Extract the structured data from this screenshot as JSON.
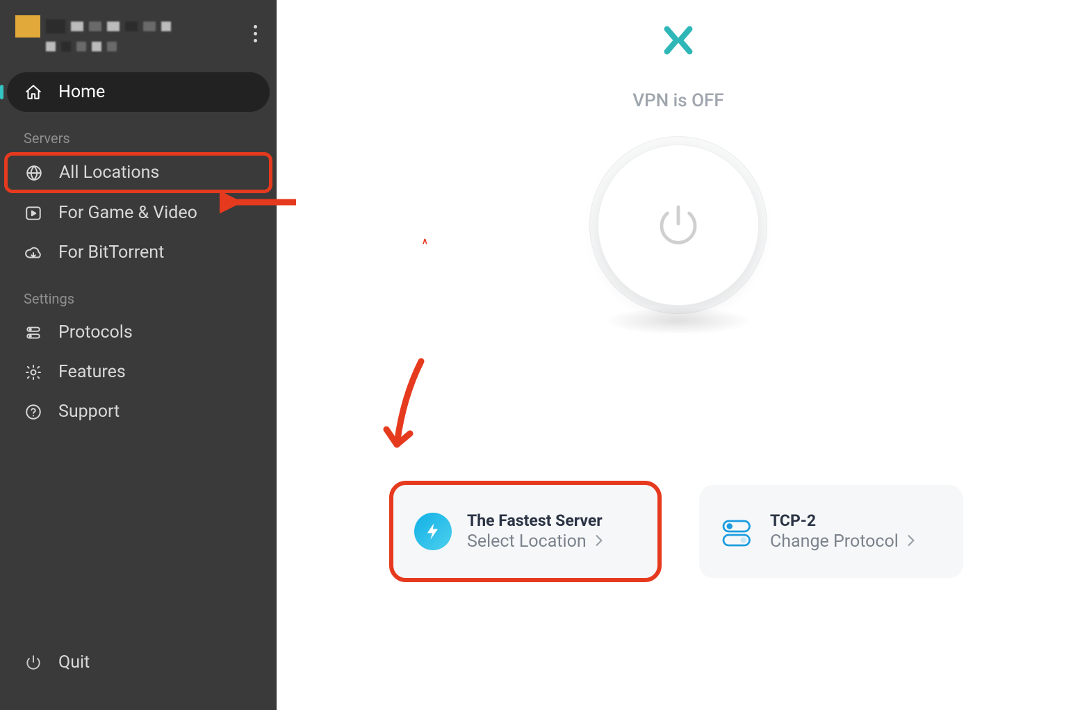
{
  "colors": {
    "accent": "#35c4c4",
    "annotate": "#e63a1f",
    "sidebar_bg": "#3a3a3b",
    "muted": "#8f8f90"
  },
  "sidebar": {
    "home_label": "Home",
    "section_servers": "Servers",
    "section_settings": "Settings",
    "items": {
      "all_locations": "All Locations",
      "game_video": "For Game & Video",
      "bittorrent": "For BitTorrent",
      "protocols": "Protocols",
      "features": "Features",
      "support": "Support",
      "quit": "Quit"
    }
  },
  "main": {
    "status": "VPN is OFF",
    "server_card": {
      "title": "The Fastest Server",
      "sub": "Select Location"
    },
    "protocol_card": {
      "title": "TCP-2",
      "sub": "Change Protocol"
    }
  }
}
